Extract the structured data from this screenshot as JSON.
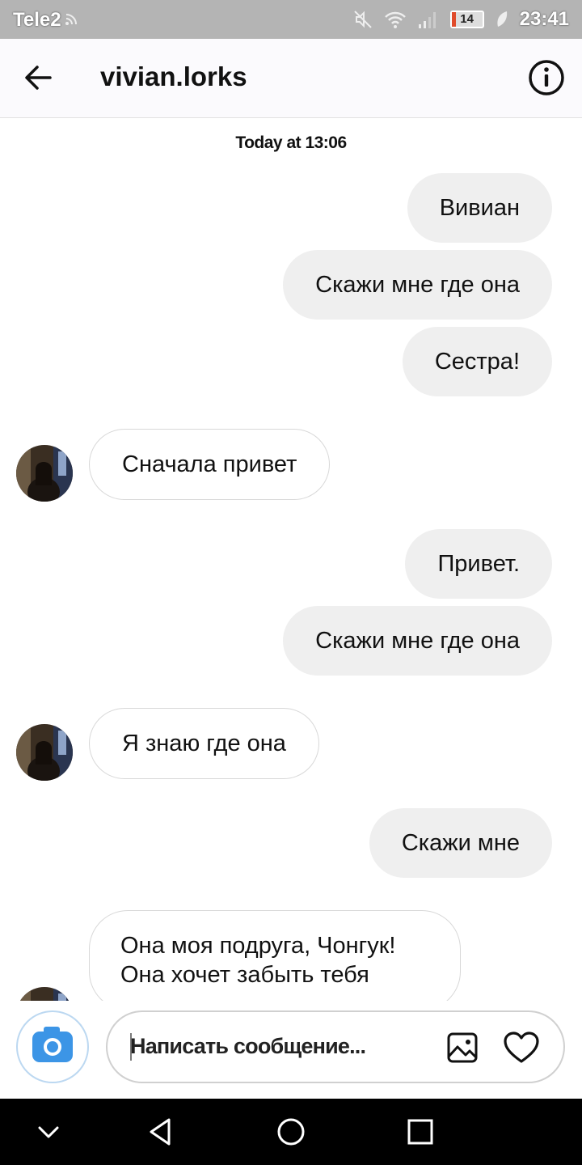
{
  "status_bar": {
    "carrier": "Tele2",
    "battery": "14",
    "time": "23:41",
    "icons": [
      "rss-icon",
      "mute-icon",
      "wifi-icon",
      "signal-icon",
      "battery-icon",
      "leaf-icon"
    ]
  },
  "header": {
    "title": "vivian.lorks",
    "back_icon": "arrow-left-icon",
    "info_icon": "info-icon"
  },
  "chat": {
    "timestamp": "Today at 13:06",
    "messages": [
      {
        "direction": "out",
        "text": "Вивиан"
      },
      {
        "direction": "out",
        "text": "Скажи мне где она"
      },
      {
        "direction": "out",
        "text": "Сестра!"
      },
      {
        "direction": "in",
        "text": "Сначала привет"
      },
      {
        "direction": "out",
        "text": "Привет."
      },
      {
        "direction": "out",
        "text": "Скажи мне где она"
      },
      {
        "direction": "in",
        "text": "Я знаю где она"
      },
      {
        "direction": "out",
        "text": "Скажи мне"
      },
      {
        "direction": "in",
        "text": "Она моя подруга, Чонгук! Она хочет забыть тебя"
      }
    ]
  },
  "composer": {
    "placeholder": "Написать сообщение...",
    "camera_icon": "camera-icon",
    "gallery_icon": "image-icon",
    "like_icon": "heart-icon"
  },
  "nav_bar": {
    "icons": [
      "chevron-down-icon",
      "back-triangle-icon",
      "home-circle-icon",
      "recents-square-icon"
    ]
  },
  "colors": {
    "status_bar_bg": "#b4b4b4",
    "outgoing_bubble": "#efefef",
    "incoming_border": "#d8d8d8",
    "camera_blue": "#3c95e6",
    "nav_bar_bg": "#000000"
  }
}
